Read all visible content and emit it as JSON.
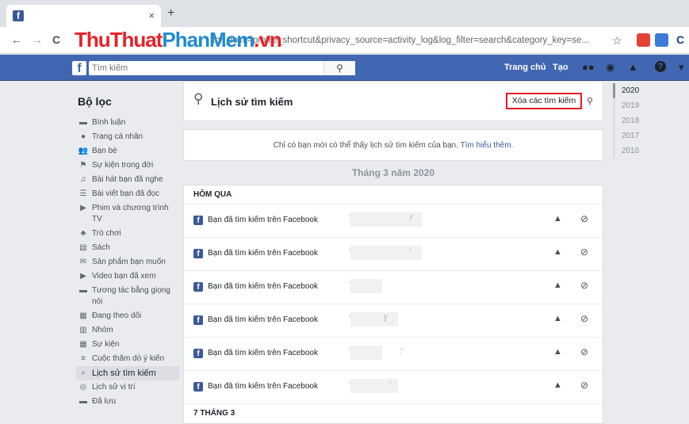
{
  "browser": {
    "tab_favicon": "f",
    "tab_close": "×",
    "new_tab": "+",
    "back": "←",
    "forward": "→",
    "reload": "C",
    "watermark_a": "ThuThuat",
    "watermark_b": "PhanMem",
    "watermark_c": ".vn",
    "url_text": "try_point=profile_shortcut&privacy_source=activity_log&log_filter=search&category_key=se...",
    "star": "☆"
  },
  "fbbar": {
    "logo": "f",
    "search_placeholder": "Tìm kiếm",
    "search_icon": "🔍",
    "home": "Trang chủ",
    "create": "Tạo",
    "friends_icon": "👥",
    "messenger_icon": "◉",
    "bell_icon": "🔔",
    "help_icon": "?",
    "menu_icon": "▾"
  },
  "sidebar": {
    "title": "Bộ lọc",
    "items": [
      {
        "icon": "▬",
        "label": "Bình luận"
      },
      {
        "icon": "●",
        "label": "Trang cá nhân"
      },
      {
        "icon": "👥",
        "label": "Bạn bè"
      },
      {
        "icon": "⚑",
        "label": "Sự kiện trong đời"
      },
      {
        "icon": "♫",
        "label": "Bài hát bạn đã nghe"
      },
      {
        "icon": "☰",
        "label": "Bài viết bạn đã đọc"
      },
      {
        "icon": "▶",
        "label": "Phim và chương trình TV"
      },
      {
        "icon": "♣",
        "label": "Trò chơi"
      },
      {
        "icon": "▤",
        "label": "Sách"
      },
      {
        "icon": "✉",
        "label": "Sản phẩm bạn muốn"
      },
      {
        "icon": "▶",
        "label": "Video bạn đã xem"
      },
      {
        "icon": "▬",
        "label": "Tương tác bằng giọng nói"
      },
      {
        "icon": "▦",
        "label": "Đang theo dõi"
      },
      {
        "icon": "▥",
        "label": "Nhóm"
      },
      {
        "icon": "▦",
        "label": "Sự kiện"
      },
      {
        "icon": "≡",
        "label": "Cuộc thăm dò ý kiến"
      },
      {
        "icon": "⌕",
        "label": "Lịch sử tìm kiếm"
      },
      {
        "icon": "◎",
        "label": "Lịch sử vị trí"
      },
      {
        "icon": "▬",
        "label": "Đã lưu"
      }
    ]
  },
  "main": {
    "title": "Lịch sử tìm kiếm",
    "clear_button": "Xóa các tìm kiếm",
    "notice_text": "Chỉ có bạn mới có thể thấy lịch sử tìm kiếm của bạn.",
    "notice_link": "Tìm hiểu thêm.",
    "month": "Tháng 3 năm 2020",
    "group1": "HÔM QUA",
    "row_text": "Bạn đã tìm kiếm trên Facebook",
    "lock_icon": "🔒",
    "hide_icon": "⊘",
    "group2": "7 THÁNG 3",
    "rows": [
      {
        "q": "'                              /'"
      },
      {
        "q": "'                              '"
      },
      {
        "q": "'"
      },
      {
        "q": "'                 )'"
      },
      {
        "q": "'                         :'"
      },
      {
        "q": "'                    '"
      }
    ]
  },
  "years": [
    "2020",
    "2019",
    "2018",
    "2017",
    "2016"
  ]
}
